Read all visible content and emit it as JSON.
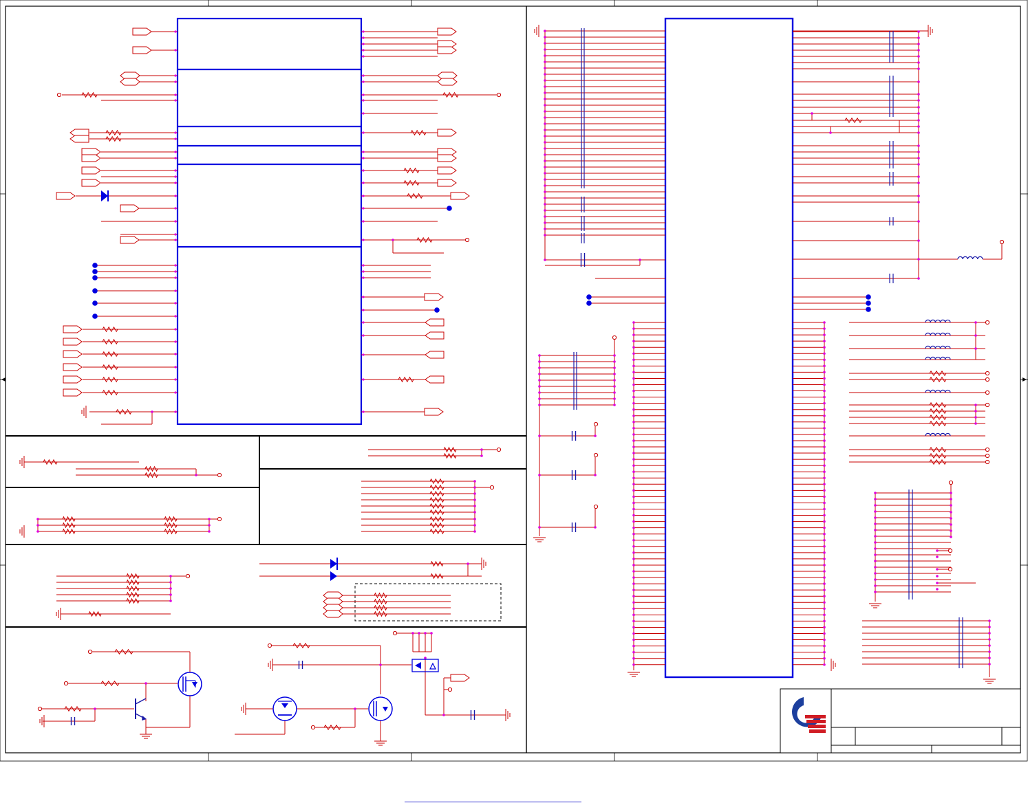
{
  "document": {
    "kind": "schematic-sheet",
    "text_labels": []
  },
  "colors": {
    "frame": "#000000",
    "ic_outline": "#0000e0",
    "wire": "#c80000",
    "bus_wire": "#1a1aa8",
    "pin_dot": "#e000e0",
    "junction": "#0000e0",
    "logo_blue": "#1c3f9e",
    "logo_red": "#d01c24"
  },
  "icons": [
    "resistor-icon",
    "capacitor-icon",
    "inductor-icon",
    "diode-icon",
    "mosfet-icon",
    "npn-transistor-icon",
    "ground-icon",
    "off-page-connector-icon",
    "junction-dot-icon",
    "company-logo-icon"
  ]
}
